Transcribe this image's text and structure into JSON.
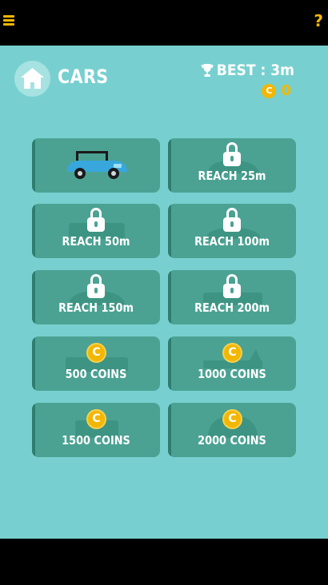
{
  "header": {
    "menu_icon": "hamburger-menu-icon",
    "help_label": "?",
    "title": "CARS",
    "best_label": "BEST : 3m",
    "coins": "0",
    "colors": {
      "accent": "#f2b705",
      "background": "#77d0cf",
      "card": "#4ba293",
      "card_edge": "#2e7d6f"
    }
  },
  "cars": [
    {
      "label": "",
      "state": "selected",
      "icon": "blue-convertible-car-icon"
    },
    {
      "label": "REACH 25m",
      "state": "locked",
      "icon": "lock-icon"
    },
    {
      "label": "REACH 50m",
      "state": "locked",
      "icon": "lock-icon"
    },
    {
      "label": "REACH 100m",
      "state": "locked",
      "icon": "lock-icon"
    },
    {
      "label": "REACH 150m",
      "state": "locked",
      "icon": "lock-icon"
    },
    {
      "label": "REACH 200m",
      "state": "locked",
      "icon": "lock-icon"
    },
    {
      "label": "500 COINS",
      "state": "purchasable",
      "icon": "coin-icon"
    },
    {
      "label": "1000 COINS",
      "state": "purchasable",
      "icon": "coin-icon"
    },
    {
      "label": "1500 COINS",
      "state": "purchasable",
      "icon": "coin-icon"
    },
    {
      "label": "2000 COINS",
      "state": "purchasable",
      "icon": "coin-icon"
    }
  ]
}
